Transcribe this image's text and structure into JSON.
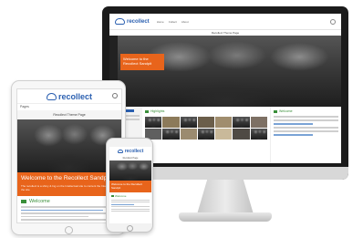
{
  "brand": {
    "name": "recollect",
    "accent_orange": "#e8641b",
    "accent_blue": "#2a5fb0",
    "accent_green": "#3a8f3a"
  },
  "monitor": {
    "nav_items": [
      "Home",
      "Collect",
      "About"
    ],
    "page_title": "Recollect Theme Page",
    "hero_text": "Welcome to the Recollect Sandpit",
    "highlights_label": "Highlights",
    "welcome_label": "Welcome"
  },
  "tablet": {
    "menu_label": "Pages",
    "page_title": "Recollect Theme Page",
    "hero_heading": "Welcome to the Recollect Sandpit",
    "hero_subtext": "The recollect is a shiny & Ing on the Intellectual site to content the Intellectual of the site",
    "section_label": "Welcome"
  },
  "phone": {
    "page_title": "Recollect Page",
    "hero_heading": "Welcome to the Recollect Sandpit",
    "section_label": "Welcome"
  },
  "icons": {
    "search": "search-icon",
    "logo": "cloud-logo-icon",
    "section": "flag-icon"
  }
}
